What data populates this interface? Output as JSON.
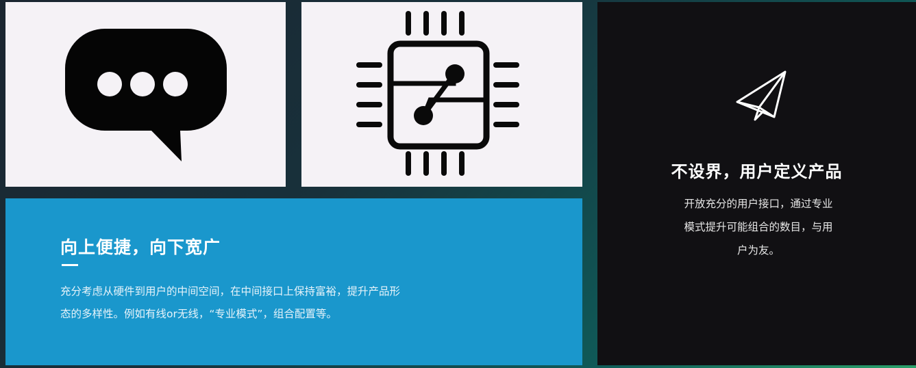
{
  "tiles": {
    "chat": {
      "icon": "speech-bubble-ellipsis-icon"
    },
    "chip": {
      "icon": "circuit-chip-icon"
    },
    "blue": {
      "title": "向上便捷，向下宽广",
      "body_lines": [
        "充分考虑从硬件到用户的中间空间，在中间接口上保持富裕，提升产品形",
        "态的多样性。例如有线or无线，“专业模式”，组合配置等。"
      ]
    },
    "dark": {
      "icon": "paper-plane-icon",
      "title": "不设界，用户定义产品",
      "body_lines": [
        "开放充分的用户接口，通过专业",
        "模式提升可能组合的数目，与用",
        "户为友。"
      ]
    }
  },
  "colors": {
    "light_tile": "#f5f2f6",
    "blue_tile": "#1a97cc",
    "dark_tile": "#111013"
  }
}
